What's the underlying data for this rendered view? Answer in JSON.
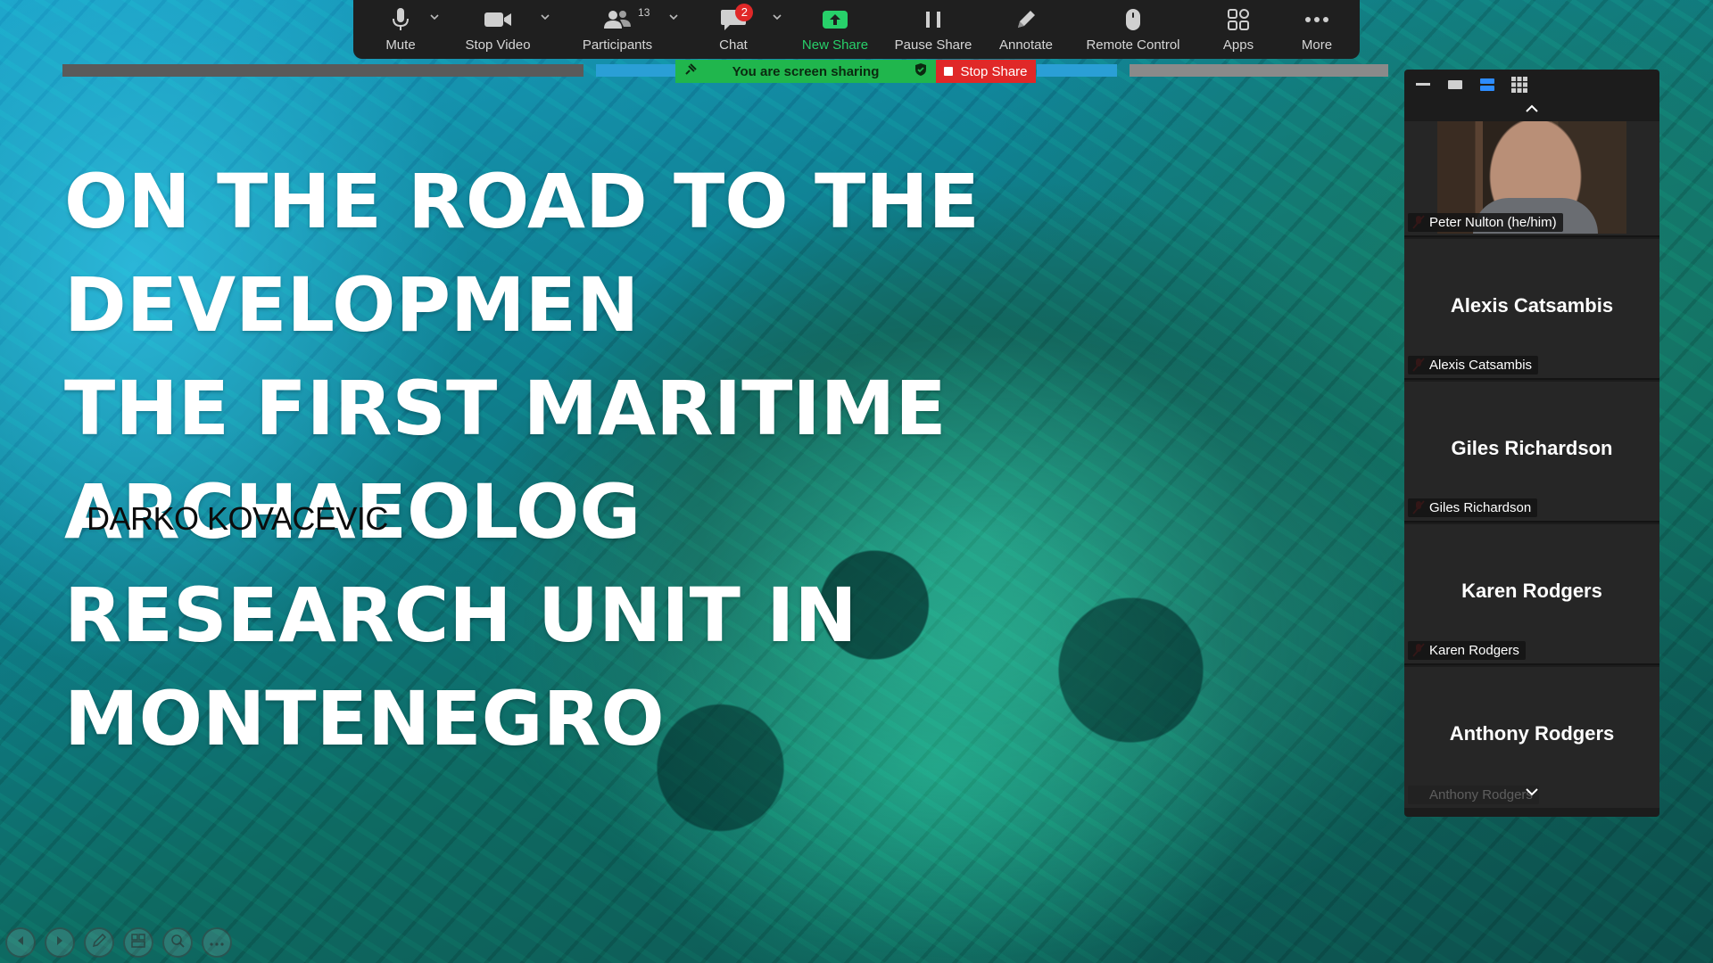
{
  "slide": {
    "title": "ON THE ROAD TO THE DEVELOPMEN\nTHE FIRST MARITIME ARCHAEOLOG\nRESEARCH UNIT IN MONTENEGRO",
    "author": "DARKO KOVACEVIC"
  },
  "toolbar": {
    "mute_label": "Mute",
    "stop_video_label": "Stop Video",
    "participants_label": "Participants",
    "participants_count": "13",
    "chat_label": "Chat",
    "chat_badge": "2",
    "new_share_label": "New Share",
    "pause_share_label": "Pause Share",
    "annotate_label": "Annotate",
    "remote_control_label": "Remote Control",
    "apps_label": "Apps",
    "more_label": "More"
  },
  "share_status": {
    "sharing_text": "You are screen sharing",
    "stop_share_label": "Stop Share"
  },
  "participants": [
    {
      "display_name": "Peter Nulton (he/him)",
      "video": true
    },
    {
      "big_name": "Alexis Catsambis",
      "display_name": "Alexis Catsambis"
    },
    {
      "big_name": "Giles Richardson",
      "display_name": "Giles Richardson"
    },
    {
      "big_name": "Karen Rodgers",
      "display_name": "Karen Rodgers"
    },
    {
      "big_name": "Anthony Rodgers",
      "display_name": "Anthony Rodgers"
    }
  ],
  "icons": {
    "toolbar": [
      "microphone-icon",
      "video-camera-icon",
      "participants-icon",
      "chat-icon",
      "share-arrow-icon",
      "pause-icon",
      "pencil-icon",
      "mouse-icon",
      "apps-icon",
      "more-dots-icon"
    ],
    "slideshow": [
      "previous-icon",
      "next-icon",
      "pen-icon",
      "slides-grid-icon",
      "zoom-icon",
      "more-icon"
    ]
  },
  "colors": {
    "toolbar_bg": "#1f1f1f",
    "green_accent": "#27d06a",
    "sharing_pill": "#20b64d",
    "stop_red": "#e02828",
    "panel_bg": "#1c1c1c"
  }
}
